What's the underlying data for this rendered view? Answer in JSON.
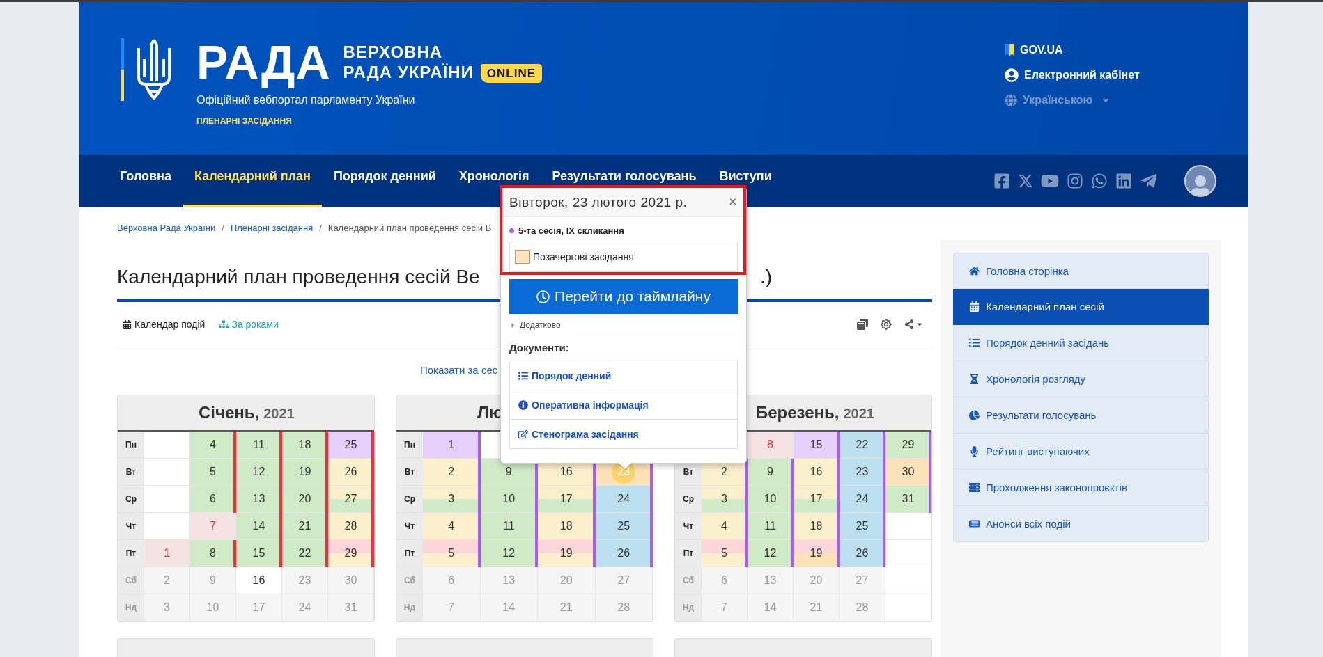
{
  "header": {
    "logo_word": "РАДА",
    "logo_line_1": "ВЕРХОВНА",
    "logo_line_2": "РАДА УКРАЇНИ",
    "badge": "ONLINE",
    "subtitle": "Офіційний вебпортал парламенту України",
    "section": "ПЛЕНАРНІ ЗАСІДАННЯ",
    "links": [
      {
        "label": "GOV.UA",
        "disabled": false
      },
      {
        "label": "Електронний кабінет",
        "disabled": false
      },
      {
        "label": "Українською",
        "disabled": true
      }
    ]
  },
  "nav": [
    {
      "label": "Головна",
      "selected": false
    },
    {
      "label": "Календарний план",
      "selected": true
    },
    {
      "label": "Порядок денний",
      "selected": false
    },
    {
      "label": "Хронологія",
      "selected": false
    },
    {
      "label": "Результати голосувань",
      "selected": false
    },
    {
      "label": "Виступи",
      "selected": false
    }
  ],
  "breadcrumbs": [
    {
      "kind": "link",
      "label": "Верховна Рада України"
    },
    {
      "kind": "separator",
      "label": "/"
    },
    {
      "kind": "link",
      "label": "Пленарні засідання"
    },
    {
      "kind": "separator",
      "label": "/"
    },
    {
      "kind": "current",
      "label": "Календарний план проведення сесій В"
    }
  ],
  "title": {
    "start": "Календарний план проведення сесій Ве",
    "end": ".)"
  },
  "toolbar": {
    "calendar_view": "Календар подій",
    "years_view": "За роками"
  },
  "show_link": "Показати за сес",
  "calendars": [
    {
      "name": "Січень,",
      "year": "2021",
      "weekdays": [
        "Пн",
        "Вт",
        "Ср",
        "Чт",
        "Пт",
        "Сб",
        "Нд"
      ],
      "weeks": [
        {
          "cells": [
            {
              "kind": "blank"
            },
            {
              "kind": "blank"
            },
            {
              "kind": "blank"
            },
            {
              "kind": "blank"
            },
            {
              "kind": "holiday",
              "day": "1",
              "color": "#f5e3e3",
              "selected": false
            },
            {
              "kind": "weekend",
              "day": "2"
            },
            {
              "kind": "weekend",
              "day": "3"
            }
          ]
        },
        {
          "cells": [
            {
              "kind": "day",
              "day": "4",
              "color": "#d0e9c6",
              "marker": {
                "color": "#f0303a"
              },
              "selected": false
            },
            {
              "kind": "day",
              "day": "5",
              "color": "#d0e9c6",
              "marker": {
                "color": "#f0303a"
              },
              "selected": false
            },
            {
              "kind": "day",
              "day": "6",
              "color": "#d0e9c6",
              "marker": {
                "color": "#f0303a"
              },
              "selected": false
            },
            {
              "kind": "holiday",
              "day": "7",
              "color": "#f5e3e3",
              "selected": false
            },
            {
              "kind": "day",
              "day": "8",
              "color": "#d0e9c6",
              "marker": {
                "color": "#f0303a"
              },
              "selected": false
            },
            {
              "kind": "weekend",
              "day": "9"
            },
            {
              "kind": "weekend",
              "day": "10"
            }
          ]
        },
        {
          "cells": [
            {
              "kind": "day",
              "day": "11",
              "color": "#d0e9c6",
              "marker": {
                "color": "#f0303a"
              },
              "selected": false
            },
            {
              "kind": "day",
              "day": "12",
              "color": "#d0e9c6",
              "marker": {
                "color": "#f0303a"
              },
              "selected": false
            },
            {
              "kind": "day",
              "day": "13",
              "color": "#d0e9c6",
              "marker": {
                "color": "#f0303a"
              },
              "selected": false
            },
            {
              "kind": "day",
              "day": "14",
              "color": "#d0e9c6",
              "marker": {
                "color": "#f0303a"
              },
              "selected": false
            },
            {
              "kind": "day",
              "day": "15",
              "color": "#d0e9c6",
              "marker": {
                "color": "#f0303a"
              },
              "selected": false
            },
            {
              "kind": "day",
              "day": "16",
              "color": "#ffffff",
              "selected": false
            },
            {
              "kind": "weekend",
              "day": "17"
            }
          ]
        },
        {
          "cells": [
            {
              "kind": "day",
              "day": "18",
              "color": "#d0e9c6",
              "marker": {
                "color": "#f0303a"
              },
              "selected": false
            },
            {
              "kind": "day",
              "day": "19",
              "color": "#d0e9c6",
              "marker": {
                "color": "#f0303a"
              },
              "selected": false
            },
            {
              "kind": "day",
              "day": "20",
              "color": "#d0e9c6",
              "marker": {
                "color": "#f0303a"
              },
              "selected": false
            },
            {
              "kind": "day",
              "day": "21",
              "color": "#d0e9c6",
              "marker": {
                "color": "#f0303a"
              },
              "selected": false
            },
            {
              "kind": "day",
              "day": "22",
              "color": "#d0e9c6",
              "marker": {
                "color": "#f0303a"
              },
              "selected": false
            },
            {
              "kind": "weekend",
              "day": "23"
            },
            {
              "kind": "weekend",
              "day": "24"
            }
          ]
        },
        {
          "cells": [
            {
              "kind": "day",
              "day": "25",
              "color": "#e6d0fb",
              "marker": {
                "color": "#f0303a"
              },
              "selected": false
            },
            {
              "kind": "day",
              "day": "26",
              "color": "#fcf0cc",
              "marker": {
                "color": "#f0303a"
              },
              "selected": false
            },
            {
              "kind": "day",
              "day": "27",
              "color": "#fcf0cc",
              "lower": {
                "color": "#d0e9c6"
              },
              "marker": {
                "color": "#f0303a"
              },
              "selected": false
            },
            {
              "kind": "day",
              "day": "28",
              "color": "#fcf0cc",
              "marker": {
                "color": "#f0303a"
              },
              "selected": false
            },
            {
              "kind": "day",
              "day": "29",
              "color": "#fbd5d8",
              "lower": {
                "color": "#fcf0cc"
              },
              "marker": {
                "color": "#f0303a"
              },
              "selected": false
            },
            {
              "kind": "weekend",
              "day": "30"
            },
            {
              "kind": "weekend",
              "day": "31"
            }
          ]
        }
      ]
    },
    {
      "name": "Лю",
      "weekdays": [
        "Пн",
        "Вт",
        "Ср",
        "Чт",
        "Пт",
        "Сб",
        "Нд"
      ],
      "weeks": [
        {
          "cells": [
            {
              "kind": "day",
              "day": "1",
              "color": "#e6d0fb",
              "marker": {
                "color": "#a95cf5"
              },
              "selected": false
            },
            {
              "kind": "day",
              "day": "2",
              "color": "#fcf0cc",
              "marker": {
                "color": "#a95cf5"
              },
              "selected": false
            },
            {
              "kind": "day",
              "day": "3",
              "color": "#fcf0cc",
              "lower": {
                "color": "#d0e9c6"
              },
              "marker": {
                "color": "#a95cf5"
              },
              "selected": false
            },
            {
              "kind": "day",
              "day": "4",
              "color": "#fcf0cc",
              "marker": {
                "color": "#a95cf5"
              },
              "selected": false
            },
            {
              "kind": "day",
              "day": "5",
              "color": "#fbd5d8",
              "lower": {
                "color": "#fcf0cc"
              },
              "marker": {
                "color": "#a95cf5"
              },
              "selected": false
            },
            {
              "kind": "weekend",
              "day": "6"
            },
            {
              "kind": "weekend",
              "day": "7"
            }
          ]
        },
        {
          "cells": [
            {
              "kind": "covered"
            },
            {
              "kind": "day",
              "day": "9",
              "color": "#d0e9c6",
              "marker": {
                "color": "#a95cf5"
              },
              "selected": false
            },
            {
              "kind": "day",
              "day": "10",
              "color": "#d0e9c6",
              "marker": {
                "color": "#a95cf5"
              },
              "selected": false
            },
            {
              "kind": "day",
              "day": "11",
              "color": "#d0e9c6",
              "marker": {
                "color": "#a95cf5"
              },
              "selected": false
            },
            {
              "kind": "day",
              "day": "12",
              "color": "#d0e9c6",
              "marker": {
                "color": "#a95cf5"
              },
              "selected": false
            },
            {
              "kind": "weekend",
              "day": "13"
            },
            {
              "kind": "weekend",
              "day": "14"
            }
          ]
        },
        {
          "cells": [
            {
              "kind": "covered"
            },
            {
              "kind": "day",
              "day": "16",
              "color": "#fcf0cc",
              "marker": {
                "color": "#a95cf5"
              },
              "selected": false
            },
            {
              "kind": "day",
              "day": "17",
              "color": "#fcf0cc",
              "lower": {
                "color": "#d0e9c6"
              },
              "marker": {
                "color": "#a95cf5"
              },
              "selected": false
            },
            {
              "kind": "day",
              "day": "18",
              "color": "#fcf0cc",
              "marker": {
                "color": "#a95cf5"
              },
              "selected": false
            },
            {
              "kind": "day",
              "day": "19",
              "color": "#fbd5d8",
              "lower": {
                "color": "#fcf0cc"
              },
              "marker": {
                "color": "#a95cf5"
              },
              "selected": false
            },
            {
              "kind": "weekend",
              "day": "20"
            },
            {
              "kind": "weekend",
              "day": "21"
            }
          ]
        },
        {
          "cells": [
            {
              "kind": "covered"
            },
            {
              "kind": "day",
              "day": "23",
              "color": "#fde1b8",
              "marker": {
                "color": "#a95cf5"
              },
              "selected": true
            },
            {
              "kind": "day",
              "day": "24",
              "color": "#bce0ef",
              "marker": {
                "color": "#a95cf5"
              },
              "selected": false
            },
            {
              "kind": "day",
              "day": "25",
              "color": "#bce0ef",
              "marker": {
                "color": "#a95cf5"
              },
              "selected": false
            },
            {
              "kind": "day",
              "day": "26",
              "color": "#bce0ef",
              "marker": {
                "color": "#a95cf5"
              },
              "selected": false
            },
            {
              "kind": "weekend",
              "day": "27"
            },
            {
              "kind": "weekend",
              "day": "28"
            }
          ]
        }
      ]
    },
    {
      "name": "Березень,",
      "year": "2021",
      "weekdays": [
        "Вт",
        "Ср",
        "Чт",
        "Пт",
        "Сб",
        "Нд"
      ],
      "weeks": [
        {
          "cells": [
            {
              "kind": "covered"
            },
            {
              "kind": "day",
              "day": "2",
              "color": "#fcf0cc",
              "marker": {
                "color": "#a95cf5"
              },
              "selected": false
            },
            {
              "kind": "day",
              "day": "3",
              "color": "#fcf0cc",
              "lower": {
                "color": "#d0e9c6"
              },
              "marker": {
                "color": "#a95cf5"
              },
              "selected": false
            },
            {
              "kind": "day",
              "day": "4",
              "color": "#fcf0cc",
              "marker": {
                "color": "#a95cf5"
              },
              "selected": false
            },
            {
              "kind": "day",
              "day": "5",
              "color": "#fbd5d8",
              "lower": {
                "color": "#fcf0cc"
              },
              "marker": {
                "color": "#a95cf5"
              },
              "selected": false
            },
            {
              "kind": "weekend",
              "day": "6"
            },
            {
              "kind": "weekend",
              "day": "7"
            }
          ]
        },
        {
          "cells": [
            {
              "kind": "holiday",
              "day": "8",
              "color": "#f5e3e3",
              "selected": false
            },
            {
              "kind": "day",
              "day": "9",
              "color": "#d0e9c6",
              "marker": {
                "color": "#a95cf5"
              },
              "selected": false
            },
            {
              "kind": "day",
              "day": "10",
              "color": "#d0e9c6",
              "marker": {
                "color": "#a95cf5"
              },
              "selected": false
            },
            {
              "kind": "day",
              "day": "11",
              "color": "#d0e9c6",
              "marker": {
                "color": "#a95cf5"
              },
              "selected": false
            },
            {
              "kind": "day",
              "day": "12",
              "color": "#d0e9c6",
              "marker": {
                "color": "#a95cf5"
              },
              "selected": false
            },
            {
              "kind": "weekend",
              "day": "13"
            },
            {
              "kind": "weekend",
              "day": "14"
            }
          ]
        },
        {
          "cells": [
            {
              "kind": "day",
              "day": "15",
              "color": "#e6d0fb",
              "marker": {
                "color": "#a95cf5"
              },
              "selected": false
            },
            {
              "kind": "day",
              "day": "16",
              "color": "#fcf0cc",
              "marker": {
                "color": "#a95cf5"
              },
              "selected": false
            },
            {
              "kind": "day",
              "day": "17",
              "color": "#fcf0cc",
              "lower": {
                "color": "#d0e9c6"
              },
              "marker": {
                "color": "#a95cf5"
              },
              "selected": false
            },
            {
              "kind": "day",
              "day": "18",
              "color": "#fcf0cc",
              "marker": {
                "color": "#a95cf5"
              },
              "selected": false
            },
            {
              "kind": "day",
              "day": "19",
              "color": "#fbd5d8",
              "lower": {
                "color": "#fde1b8"
              },
              "marker": {
                "color": "#a95cf5"
              },
              "selected": false
            },
            {
              "kind": "weekend",
              "day": "20"
            },
            {
              "kind": "weekend",
              "day": "21"
            }
          ]
        },
        {
          "cells": [
            {
              "kind": "day",
              "day": "22",
              "color": "#bce0ef",
              "marker": {
                "color": "#a95cf5"
              },
              "selected": false
            },
            {
              "kind": "day",
              "day": "23",
              "color": "#bce0ef",
              "marker": {
                "color": "#a95cf5"
              },
              "selected": false
            },
            {
              "kind": "day",
              "day": "24",
              "color": "#bce0ef",
              "marker": {
                "color": "#a95cf5"
              },
              "selected": false
            },
            {
              "kind": "day",
              "day": "25",
              "color": "#bce0ef",
              "marker": {
                "color": "#a95cf5"
              },
              "selected": false
            },
            {
              "kind": "day",
              "day": "26",
              "color": "#bce0ef",
              "marker": {
                "color": "#a95cf5"
              },
              "selected": false
            },
            {
              "kind": "weekend",
              "day": "27"
            },
            {
              "kind": "weekend",
              "day": "28"
            }
          ]
        },
        {
          "cells": [
            {
              "kind": "day",
              "day": "29",
              "color": "#d0e9c6",
              "marker": {
                "color": "#a95cf5"
              },
              "selected": false
            },
            {
              "kind": "day",
              "day": "30",
              "color": "#fde1b8",
              "marker": {
                "color": "#a95cf5"
              },
              "selected": false
            },
            {
              "kind": "day",
              "day": "31",
              "color": "#d0e9c6",
              "marker": {
                "color": "#a95cf5"
              },
              "selected": false
            },
            {
              "kind": "blank"
            },
            {
              "kind": "blank"
            },
            {
              "kind": "blank"
            },
            {
              "kind": "blank"
            }
          ]
        }
      ]
    }
  ],
  "popup": {
    "title": "Вівторок, 23 лютого 2021 р.",
    "close": "×",
    "session": {
      "label": "5-та сесія, IX скликання",
      "color": "#a95cf5"
    },
    "legend": {
      "label": "Позачергові засідання",
      "color": "#fde4bc"
    },
    "button": "Перейти до таймлайну",
    "more": "Додатково",
    "documents_title": "Документи:",
    "documents": [
      "Порядок денний",
      "Оперативна інформація",
      "Стенограма засідання"
    ]
  },
  "sidebar": [
    {
      "label": "Головна сторінка",
      "selected": false
    },
    {
      "label": "Календарний план сесій",
      "selected": true
    },
    {
      "label": "Порядок денний засідань",
      "selected": false
    },
    {
      "label": "Хронологія розгляду",
      "selected": false
    },
    {
      "label": "Результати голосувань",
      "selected": false
    },
    {
      "label": "Рейтинг виступаючих",
      "selected": false
    },
    {
      "label": "Проходження законопроєктів",
      "selected": false
    },
    {
      "label": "Анонси всіх подій",
      "selected": false
    }
  ]
}
